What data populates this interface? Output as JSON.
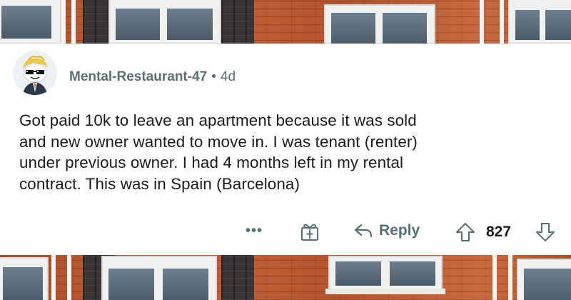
{
  "comment": {
    "username": "Mental-Restaurant-47",
    "separator": "•",
    "age": "4d",
    "body_lines": [
      "Got paid 10k to leave an apartment because it was sold",
      "and new owner wanted to move in. I was tenant (renter)",
      "under previous owner. I had 4 months left in my rental",
      "contract. This was in Spain (Barcelona)"
    ],
    "actions": {
      "more_label": "•••",
      "reply_label": "Reply",
      "score": "827"
    },
    "icons": {
      "more": "more-options-icon",
      "award": "award-icon",
      "reply": "reply-arrow-icon",
      "upvote": "upvote-arrow-icon",
      "downvote": "downvote-arrow-icon"
    }
  },
  "colors": {
    "meta_text": "#576f76",
    "body_text": "#1c1c1c",
    "brick": "#b9572f"
  }
}
